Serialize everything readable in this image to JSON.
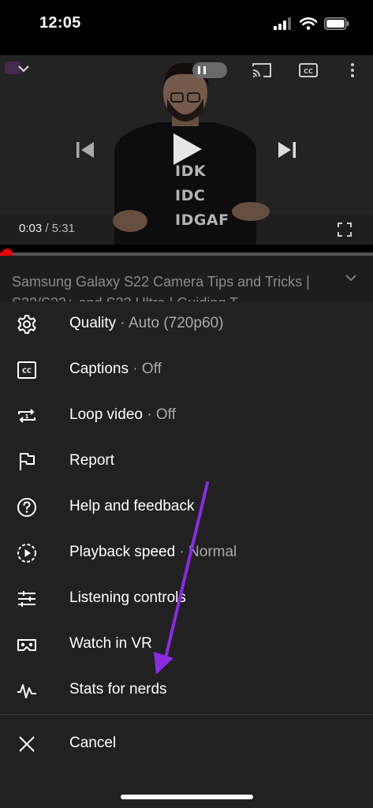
{
  "status_bar": {
    "time": "12:05"
  },
  "player": {
    "current_time": "0:03",
    "duration_text": " / 5:31",
    "progress_fraction": 0.01,
    "shirt_lines": [
      "IDK",
      "IDC",
      "IDGAF"
    ]
  },
  "video": {
    "title": "Samsung Galaxy S22 Camera Tips and Tricks | S22/S22+ and S22 Ultra | Guiding T"
  },
  "menu": {
    "items": [
      {
        "label": "Quality",
        "sep": " · ",
        "value": "Auto (720p60)",
        "icon": "gear-icon"
      },
      {
        "label": "Captions",
        "sep": " · ",
        "value": "Off",
        "icon": "captions-icon"
      },
      {
        "label": "Loop video",
        "sep": " · ",
        "value": "Off",
        "icon": "loop-icon"
      },
      {
        "label": "Report",
        "icon": "flag-icon"
      },
      {
        "label": "Help and feedback",
        "icon": "help-icon"
      },
      {
        "label": "Playback speed",
        "sep": " · ",
        "value": "Normal",
        "icon": "playback-speed-icon"
      },
      {
        "label": "Listening controls",
        "icon": "sliders-icon"
      },
      {
        "label": "Watch in VR",
        "icon": "vr-headset-icon"
      },
      {
        "label": "Stats for nerds",
        "icon": "stats-pulse-icon"
      }
    ],
    "cancel_label": "Cancel"
  },
  "colors": {
    "sheet_bg": "#212121",
    "progress_red": "#ee0000",
    "annotation_arrow": "#8a2be2"
  }
}
